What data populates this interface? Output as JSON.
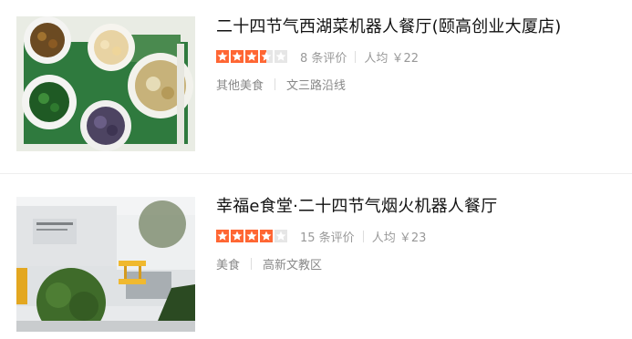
{
  "restaurants": [
    {
      "title": "二十四节气西湖菜机器人餐厅(颐高创业大厦店)",
      "rating": 3.5,
      "reviews": "8 条评价",
      "avg_price": "人均 ￥22",
      "tags": [
        "其他美食",
        "文三路沿线"
      ],
      "photo_icon": "food-dishes-photo-icon"
    },
    {
      "title": "幸福e食堂·二十四节气烟火机器人餐厅",
      "rating": 4,
      "reviews": "15 条评价",
      "avg_price": "人均 ￥23",
      "tags": [
        "美食",
        "高新文教区"
      ],
      "photo_icon": "building-exterior-photo-icon"
    }
  ],
  "colors": {
    "star_on": "#ff6633",
    "star_off": "#e6e6e6",
    "title": "#111111",
    "meta": "#999999"
  }
}
